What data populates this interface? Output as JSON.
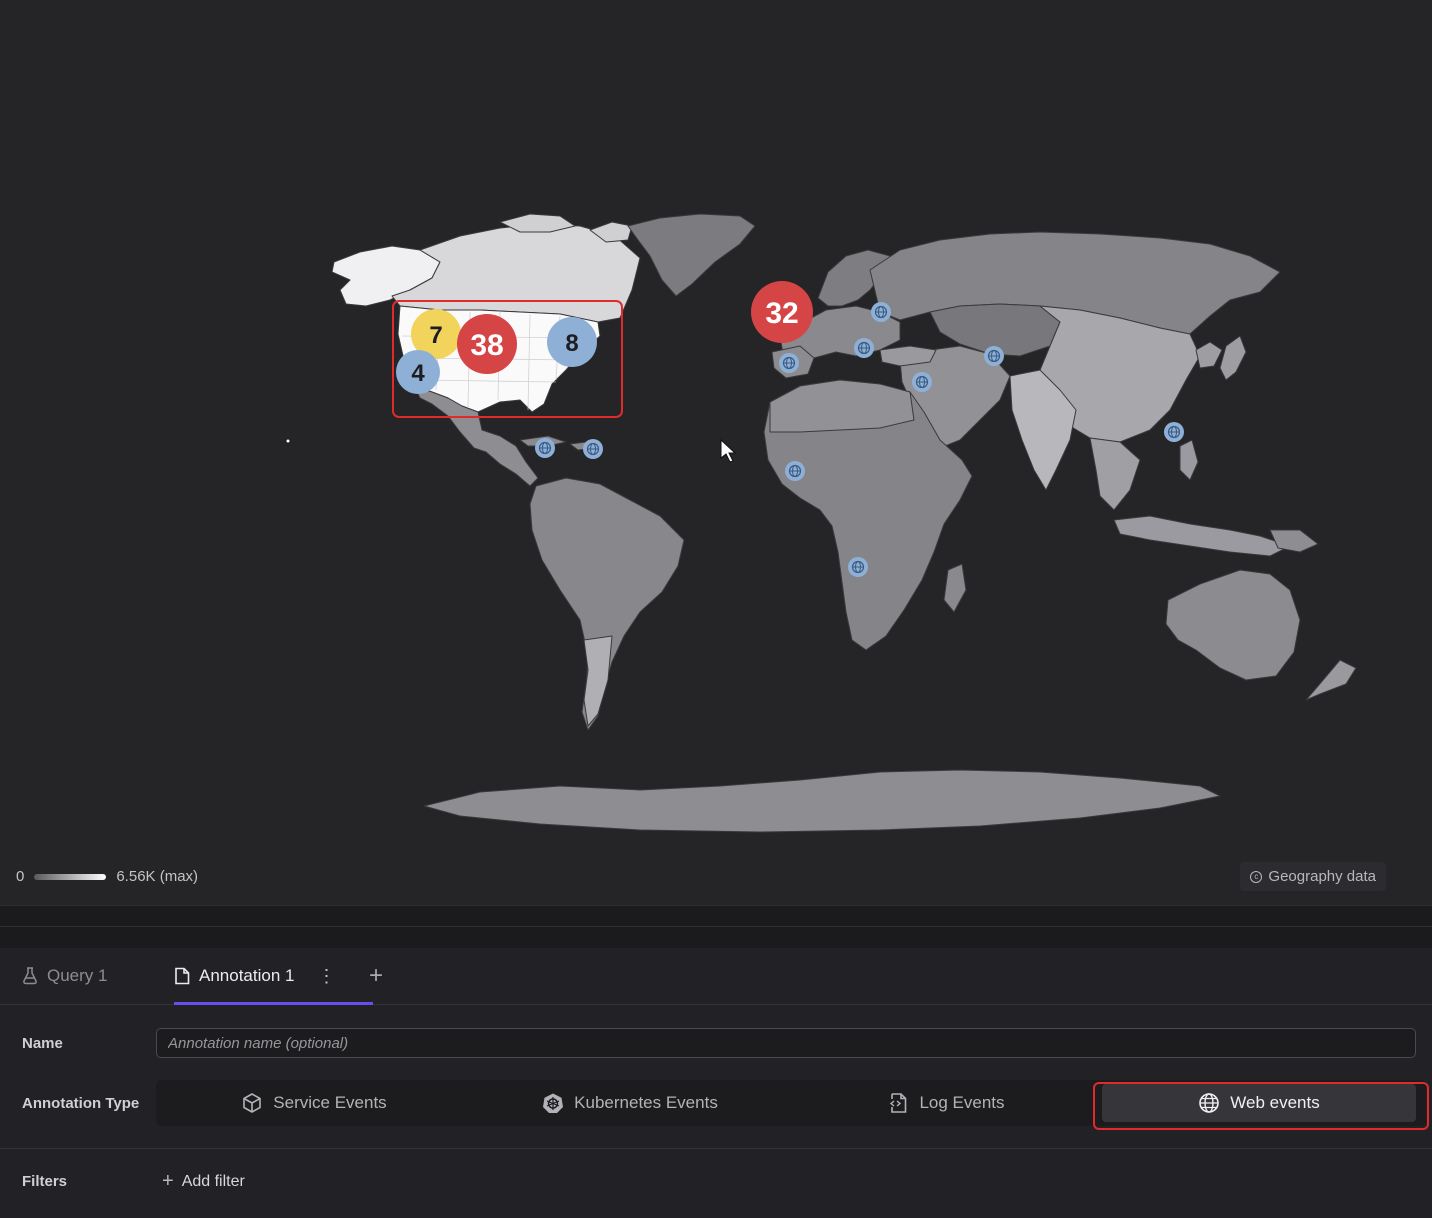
{
  "map": {
    "legend_min": "0",
    "legend_max": "6.56K (max)",
    "attribution": "Geography data",
    "clusters": [
      {
        "label": "7",
        "region": "US West",
        "color": "#f2d35b"
      },
      {
        "label": "38",
        "region": "US Central",
        "color": "#d64545"
      },
      {
        "label": "8",
        "region": "US East",
        "color": "#8fb0d6"
      },
      {
        "label": "4",
        "region": "US Southwest",
        "color": "#8fb0d6"
      },
      {
        "label": "32",
        "region": "Western Europe",
        "color": "#d64545"
      }
    ],
    "single_markers": [
      "Caribbean",
      "Puerto Rico",
      "Iberia",
      "Italy",
      "Eastern Europe",
      "Turkey",
      "Central Asia",
      "West Africa",
      "Angola",
      "Taiwan"
    ],
    "marker_icon": "globe-icon"
  },
  "tabs": [
    {
      "label": "Query 1",
      "icon": "flask-icon",
      "active": false
    },
    {
      "label": "Annotation 1",
      "icon": "document-icon",
      "active": true
    }
  ],
  "tab_add_label": "+",
  "form": {
    "name_label": "Name",
    "name_placeholder": "Annotation name (optional)",
    "type_label": "Annotation Type",
    "types": [
      {
        "label": "Service Events",
        "icon": "cube-icon"
      },
      {
        "label": "Kubernetes Events",
        "icon": "kubernetes-icon"
      },
      {
        "label": "Log Events",
        "icon": "log-file-icon"
      },
      {
        "label": "Web events",
        "icon": "globe-icon",
        "selected": true
      }
    ],
    "filters_label": "Filters",
    "add_filter_label": "Add filter"
  },
  "colors": {
    "accent": "#6a4cf0",
    "highlight": "#e02b2b",
    "land_dark": "#808084",
    "land_light": "#e4e4e6"
  }
}
